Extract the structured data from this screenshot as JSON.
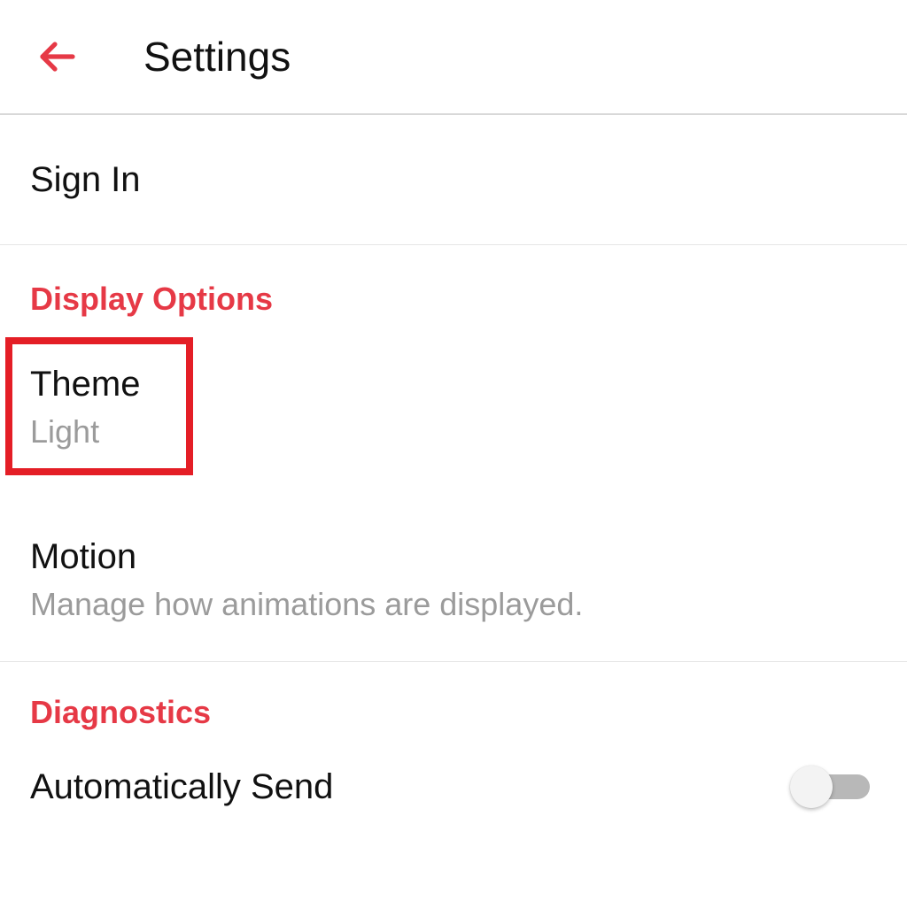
{
  "header": {
    "title": "Settings"
  },
  "signin": {
    "label": "Sign In"
  },
  "sections": {
    "display": {
      "header": "Display Options",
      "theme": {
        "title": "Theme",
        "value": "Light"
      },
      "motion": {
        "title": "Motion",
        "subtitle": "Manage how animations are displayed."
      }
    },
    "diagnostics": {
      "header": "Diagnostics",
      "auto_send": {
        "title": "Automatically Send",
        "enabled": false
      }
    }
  },
  "colors": {
    "accent": "#e63946",
    "highlight": "#e41e26"
  }
}
